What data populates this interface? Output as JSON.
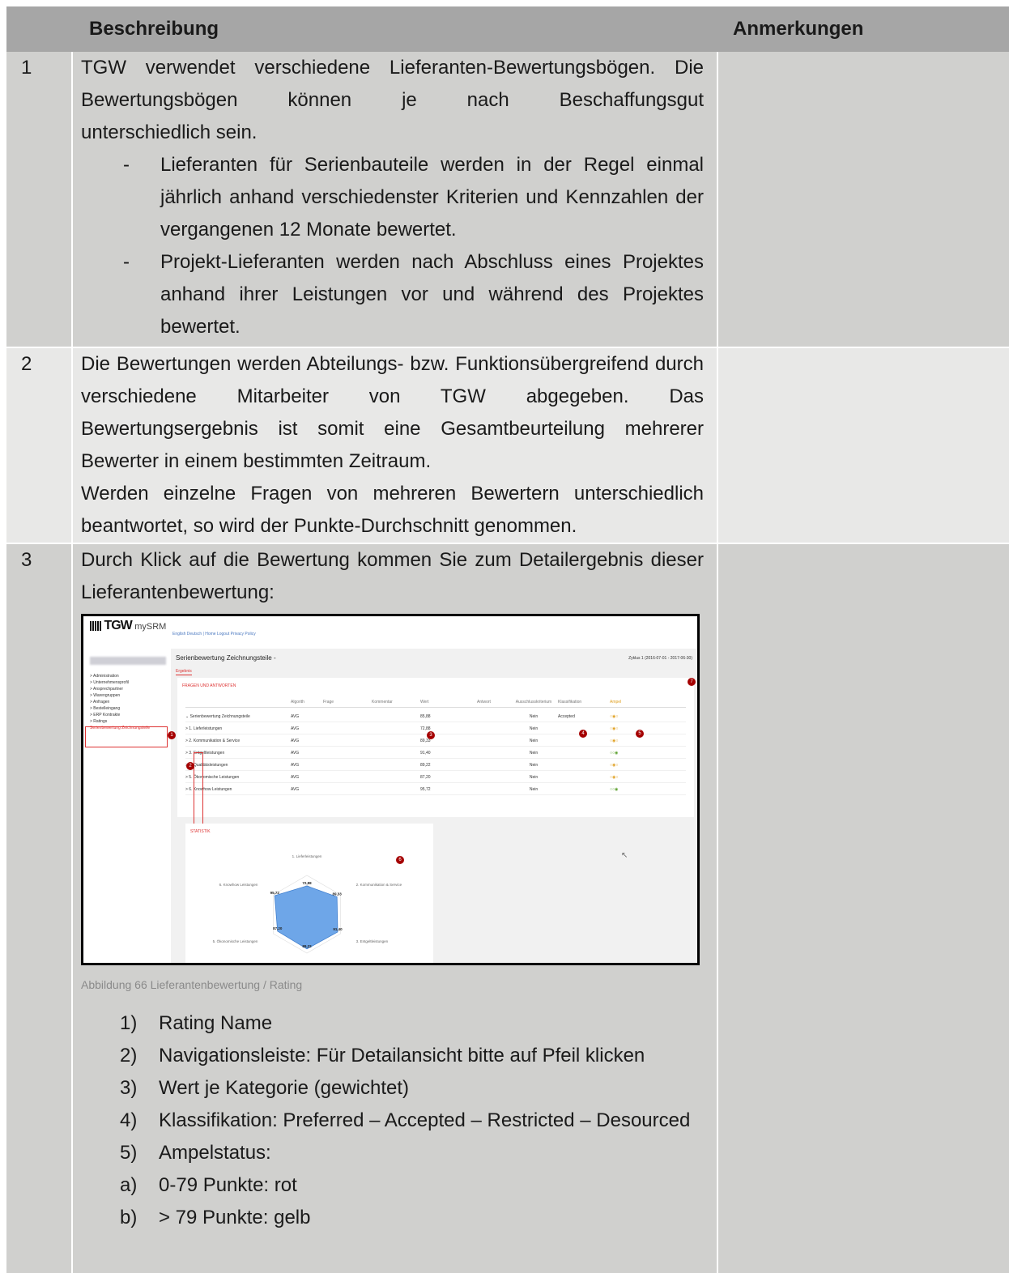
{
  "header": {
    "col_description": "Beschreibung",
    "col_remarks": "Anmerkungen"
  },
  "rows": {
    "r1": {
      "num": "1",
      "line1": "TGW verwendet verschiedene Lieferanten-Bewertungsbögen. Die",
      "line2": "Bewertungsbögen können je nach Beschaffungsgut",
      "line3": "unterschiedlich sein.",
      "bullet1": "Lieferanten für Serienbauteile werden in der Regel einmal jährlich anhand verschiedenster Kriterien und Kennzahlen der vergangenen 12 Monate bewertet.",
      "bullet2": "Projekt-Lieferanten werden nach Abschluss eines Projektes anhand ihrer Leistungen vor und während des Projektes bewertet.",
      "dash": "-"
    },
    "r2": {
      "num": "2",
      "para1": "Die Bewertungen werden Abteilungs- bzw. Funktionsübergreifend durch verschiedene Mitarbeiter von TGW abgegeben. Das Bewertungsergebnis ist somit eine Gesamtbeurteilung mehrerer Bewerter in einem bestimmten Zeitraum.",
      "para2": "Werden einzelne Fragen von mehreren Bewertern unterschiedlich beantwortet, so wird der Punkte-Durchschnitt genommen."
    },
    "r3": {
      "num": "3",
      "intro": "Durch Klick auf die Bewertung kommen Sie zum Detailergebnis dieser Lieferantenbewertung:",
      "caption": "Abbildung 66 Lieferantenbewertung / Rating",
      "list": [
        {
          "n": "1)",
          "t": "Rating Name"
        },
        {
          "n": "2)",
          "t": "Navigationsleiste: Für Detailansicht bitte auf Pfeil klicken"
        },
        {
          "n": "3)",
          "t": "Wert je Kategorie (gewichtet)"
        },
        {
          "n": "4)",
          "t": "Klassifikation: Preferred – Accepted – Restricted – Desourced"
        },
        {
          "n": "5)",
          "t": "Ampelstatus:"
        }
      ],
      "sublist": [
        {
          "n": "a)",
          "t": "0-79 Punkte: rot"
        },
        {
          "n": "b)",
          "t": "> 79 Punkte: gelb"
        }
      ]
    }
  },
  "screenshot": {
    "logo": "TGW",
    "logo_suffix": "mySRM",
    "links": "English Deutsch | Home Logout Privacy Policy",
    "sidebar": [
      "Administration",
      "Unternehmensprofil",
      "Ansprechpartner",
      "Warengruppen",
      "Anfragen",
      "Bestelleingang",
      "ERP Kontrakte",
      "Ratings",
      "Serienbewertung Zeichnungsteile"
    ],
    "title": "Serienbewertung Zeichnungsteile -",
    "zyklus": "Zyklus 1 (2016-07-01 - 2017-06-30)",
    "tab": "Ergebnis",
    "section1": "FRAGEN UND ANTWORTEN",
    "section2": "STATISTIK",
    "columns": [
      "",
      "Algorith",
      "Frage",
      "Kommentar",
      "Wert",
      "Antwort",
      "Ausschlusskriterium",
      "Klassifikation",
      "Ampel"
    ],
    "table": [
      {
        "name": "Serienbewertung Zeichnungsteile",
        "alg": "AVG",
        "wert": "85,88",
        "aus": "Nein",
        "kl": "Accepted",
        "amp": "○◉○"
      },
      {
        "name": "1. Lieferleistungen",
        "alg": "AVG",
        "wert": "72,88",
        "aus": "Nein",
        "kl": "",
        "amp": "○◉○"
      },
      {
        "name": "2. Kommunikation & Service",
        "alg": "AVG",
        "wert": "89,33",
        "aus": "Nein",
        "kl": "",
        "amp": "○◉○"
      },
      {
        "name": "3. Entgeltleistungen",
        "alg": "AVG",
        "wert": "91,40",
        "aus": "Nein",
        "kl": "",
        "amp": "○○◉"
      },
      {
        "name": "4. Qualitätsleistungen",
        "alg": "AVG",
        "wert": "89,22",
        "aus": "Nein",
        "kl": "",
        "amp": "○◉○"
      },
      {
        "name": "5. Ökonomische Leistungen",
        "alg": "AVG",
        "wert": "87,20",
        "aus": "Nein",
        "kl": "",
        "amp": "○◉○"
      },
      {
        "name": "6. Knowhow Leistungen",
        "alg": "AVG",
        "wert": "95,72",
        "aus": "Nein",
        "kl": "",
        "amp": "○○◉"
      }
    ],
    "radar": {
      "labels": [
        "1. Lieferleistungen",
        "2. Kommunikation & Service",
        "3. Entgeltleistungen",
        "4. Qualitätsleistungen",
        "5. Ökonomische Leistungen",
        "6. Knowhow Leistungen"
      ],
      "values": [
        72.88,
        89.33,
        91.4,
        89.22,
        87.2,
        95.72
      ],
      "value_labels": [
        "72,88",
        "89,33",
        "91,40",
        "89,22",
        "87,20",
        "95,72"
      ]
    },
    "markers": [
      "1",
      "2",
      "3",
      "4",
      "5",
      "6",
      "7"
    ]
  }
}
